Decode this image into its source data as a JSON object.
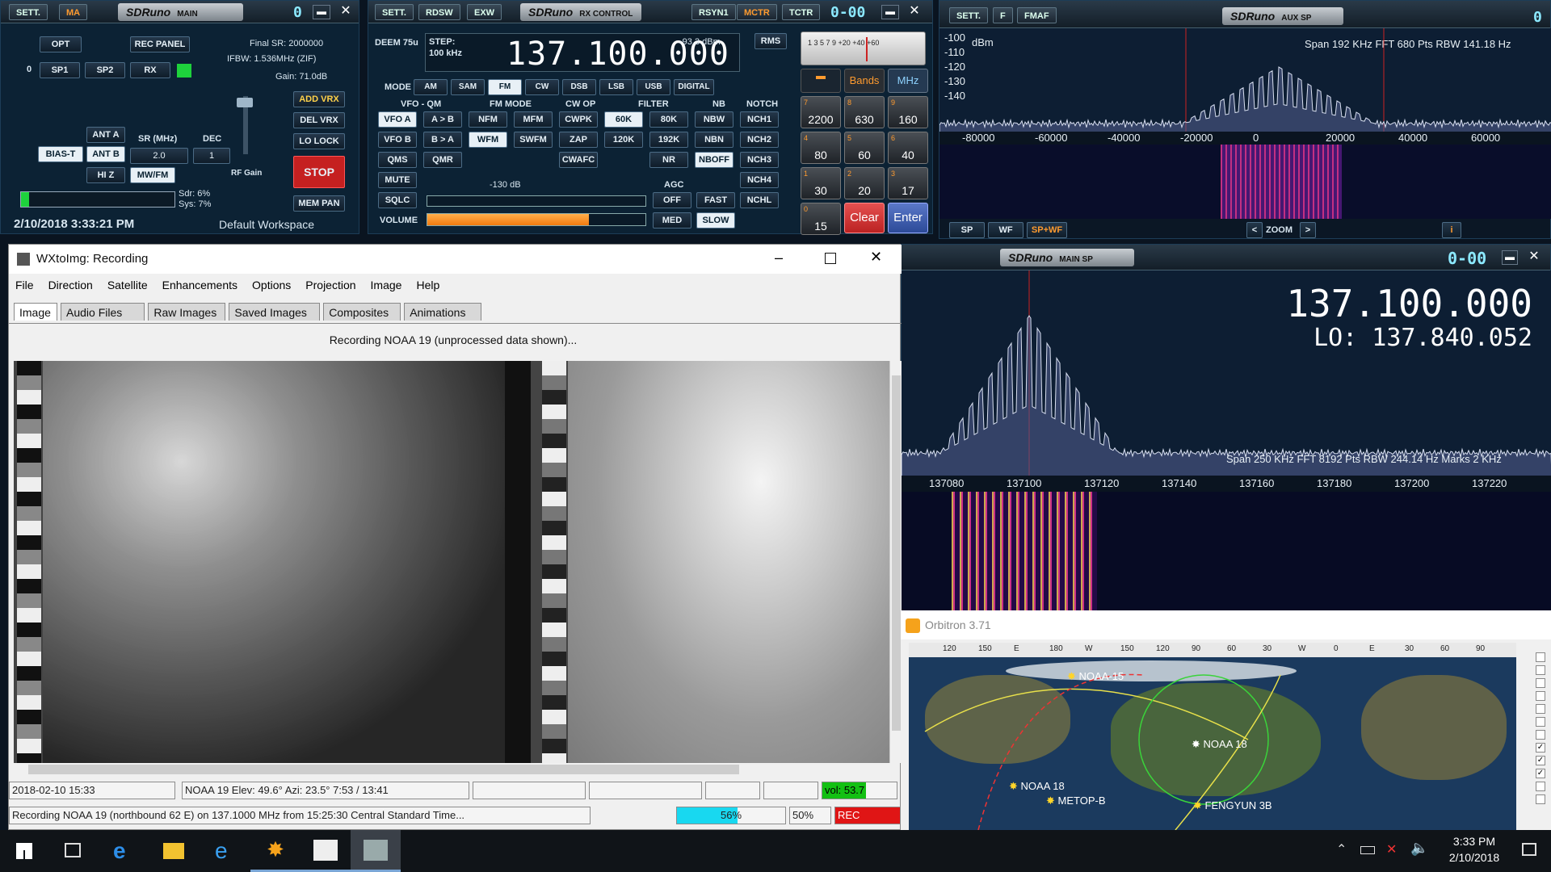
{
  "sdr_main": {
    "sett": "SETT.",
    "ma": "MA",
    "logo": "SDRuno",
    "logo_sub": "MAIN",
    "digit": "0",
    "opt": "OPT",
    "rec_panel": "REC PANEL",
    "final_sr": "Final SR: 2000000",
    "ifbw": "IFBW: 1.536MHz (ZIF)",
    "gain": "Gain: 71.0dB",
    "zero": "0",
    "sp1": "SP1",
    "sp2": "SP2",
    "rx": "RX",
    "add_vrx": "ADD VRX",
    "del_vrx": "DEL VRX",
    "lo_lock": "LO LOCK",
    "stop": "STOP",
    "mem_pan": "MEM PAN",
    "ant_a": "ANT A",
    "ant_b": "ANT B",
    "bias_t": "BIAS-T",
    "hiz": "HI Z",
    "mwfm": "MW/FM",
    "sr_label": "SR (MHz)",
    "sr_val": "2.0",
    "dec_label": "DEC",
    "dec_val": "1",
    "rf_gain": "RF Gain",
    "sdr_pct": "Sdr: 6%",
    "sys_pct": "Sys: 7%",
    "datetime": "2/10/2018 3:33:21 PM",
    "workspace": "Default Workspace"
  },
  "sdr_rx": {
    "sett": "SETT.",
    "rdsw": "RDSW",
    "exw": "EXW",
    "logo": "SDRuno",
    "logo_sub": "RX CONTROL",
    "rsyn": "RSYN1",
    "mctr": "MCTR",
    "tctr": "TCTR",
    "digits": "0-00",
    "deem": "DEEM 75u",
    "step": "STEP:",
    "step_val": "100 kHz",
    "freq": "137.100.000",
    "dbm": "-93.3 dBm",
    "rms": "RMS",
    "mode_label": "MODE",
    "modes": [
      "AM",
      "SAM",
      "FM",
      "CW",
      "DSB",
      "LSB",
      "USB",
      "DIGITAL"
    ],
    "vfo_qm": "VFO - QM",
    "fm_mode": "FM MODE",
    "cw_op": "CW OP",
    "filter": "FILTER",
    "nb": "NB",
    "notch": "NOTCH",
    "vfo_a": "VFO A",
    "a_b": "A > B",
    "nfm": "NFM",
    "mfm": "MFM",
    "cwpk": "CWPK",
    "f60k": "60K",
    "f80k": "80K",
    "nbw": "NBW",
    "nch1": "NCH1",
    "vfo_b": "VFO B",
    "b_a": "B > A",
    "wfm": "WFM",
    "swfm": "SWFM",
    "zap": "ZAP",
    "f120k": "120K",
    "f192k": "192K",
    "nbn": "NBN",
    "nch2": "NCH2",
    "qms": "QMS",
    "qmr": "QMR",
    "cwafc": "CWAFC",
    "nr": "NR",
    "nboff": "NBOFF",
    "nch3": "NCH3",
    "mute": "MUTE",
    "sq_db": "-130 dB",
    "agc": "AGC",
    "nch4": "NCH4",
    "sqlc": "SQLC",
    "off": "OFF",
    "fast": "FAST",
    "nchl": "NCHL",
    "volume": "VOLUME",
    "volume_level": 0.74,
    "med": "MED",
    "slow": "SLOW",
    "meter_scale": "1 3 5 7 9 +20 +40 +60",
    "bands": "Bands",
    "mhz": "MHz",
    "keys": [
      {
        "s": "7",
        "v": "2200"
      },
      {
        "s": "8",
        "v": "630"
      },
      {
        "s": "9",
        "v": "160"
      },
      {
        "s": "4",
        "v": "80"
      },
      {
        "s": "5",
        "v": "60"
      },
      {
        "s": "6",
        "v": "40"
      },
      {
        "s": "1",
        "v": "30"
      },
      {
        "s": "2",
        "v": "20"
      },
      {
        "s": "3",
        "v": "17"
      },
      {
        "s": "0",
        "v": "15"
      }
    ],
    "clear": "Clear",
    "enter": "Enter"
  },
  "sdr_aux": {
    "sett": "SETT.",
    "f": "F",
    "fmaf": "FMAF",
    "logo": "SDRuno",
    "logo_sub": "AUX SP",
    "digit": "0",
    "y_labels": [
      "-100",
      "-110",
      "-120",
      "-130",
      "-140"
    ],
    "dbm": "dBm",
    "info": "Span 192 KHz   FFT 680 Pts   RBW 141.18 Hz",
    "x_labels": [
      "-80000",
      "-60000",
      "-40000",
      "-20000",
      "0",
      "20000",
      "40000",
      "60000"
    ],
    "sp": "SP",
    "wf": "WF",
    "spwf": "SP+WF",
    "zoom": "ZOOM",
    "prev": "<",
    "next": ">",
    "info_btn": "i"
  },
  "sdr_mainsp": {
    "logo": "SDRuno",
    "logo_sub": "MAIN SP",
    "digits": "0-00",
    "freq": "137.100.000",
    "lo": "LO: 137.840.052",
    "info": "Span 250 KHz   FFT 8192 Pts   RBW 244.14 Hz   Marks 2 KHz",
    "x_labels": [
      "137080",
      "137100",
      "137120",
      "137140",
      "137160",
      "137180",
      "137200",
      "137220"
    ]
  },
  "wxtoimg": {
    "title": "WXtoImg: Recording",
    "menu": [
      "File",
      "Direction",
      "Satellite",
      "Enhancements",
      "Options",
      "Projection",
      "Image",
      "Help"
    ],
    "tabs": [
      "Image",
      "Audio Files",
      "Raw Images",
      "Saved Images",
      "Composites",
      "Animations"
    ],
    "banner": "Recording NOAA 19 (unprocessed data shown)...",
    "status_date": "2018-02-10  15:33",
    "status_sat": "NOAA 19   Elev: 49.6°   Azi: 23.5°   7:53 / 13:41",
    "vol": "vol: 53.7",
    "status_msg": "Recording NOAA 19 (northbound 62 E) on 137.1000 MHz from 15:25:30 Central Standard Time...",
    "progress": "56%",
    "progress_value": 0.56,
    "pct2": "50%",
    "rec": "REC"
  },
  "orbitron": {
    "title": "Orbitron 3.71",
    "lon_labels": [
      "120",
      "150",
      "E",
      "180",
      "W",
      "150",
      "120",
      "90",
      "60",
      "30",
      "W",
      "0",
      "E",
      "30",
      "60",
      "90"
    ],
    "sats": [
      "NOAA-15",
      "NOAA 18",
      "NOAA 18",
      "METOP-B",
      "FENGYUN 3B"
    ]
  },
  "taskbar": {
    "time": "3:33 PM",
    "date": "2/10/2018"
  },
  "colors": {
    "accent": "#ff9b2f",
    "spectrum": "#c8d6ea",
    "rec": "#e01515",
    "progress": "#18d8f0",
    "vol_bg": "#13c013"
  }
}
